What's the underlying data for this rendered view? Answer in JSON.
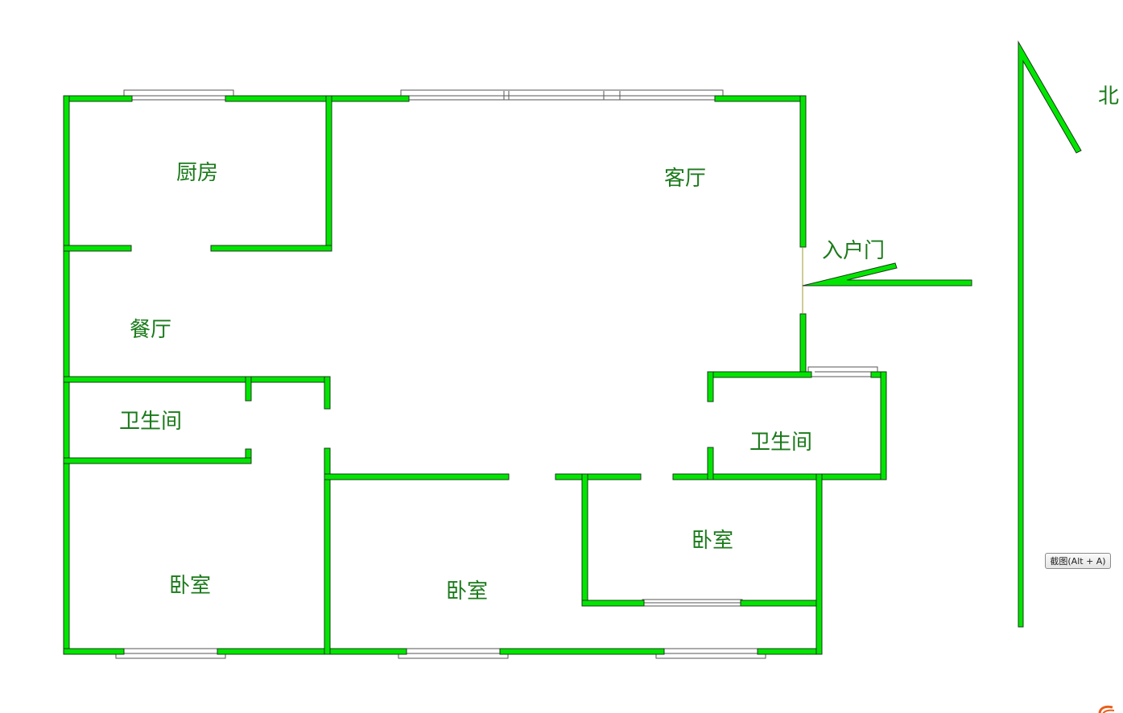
{
  "rooms": {
    "kitchen": "厨房",
    "living_room": "客厅",
    "dining_room": "餐厅",
    "bathroom_west": "卫生间",
    "bathroom_east": "卫生间",
    "bedroom_southwest": "卧室",
    "bedroom_south": "卧室",
    "bedroom_southeast": "卧室"
  },
  "entrance": {
    "label": "入户门"
  },
  "compass": {
    "label": "北"
  },
  "tooltip": {
    "label": "截图(Alt + A)"
  },
  "colors": {
    "wall": "#00e600",
    "label": "#1a7a1a"
  }
}
